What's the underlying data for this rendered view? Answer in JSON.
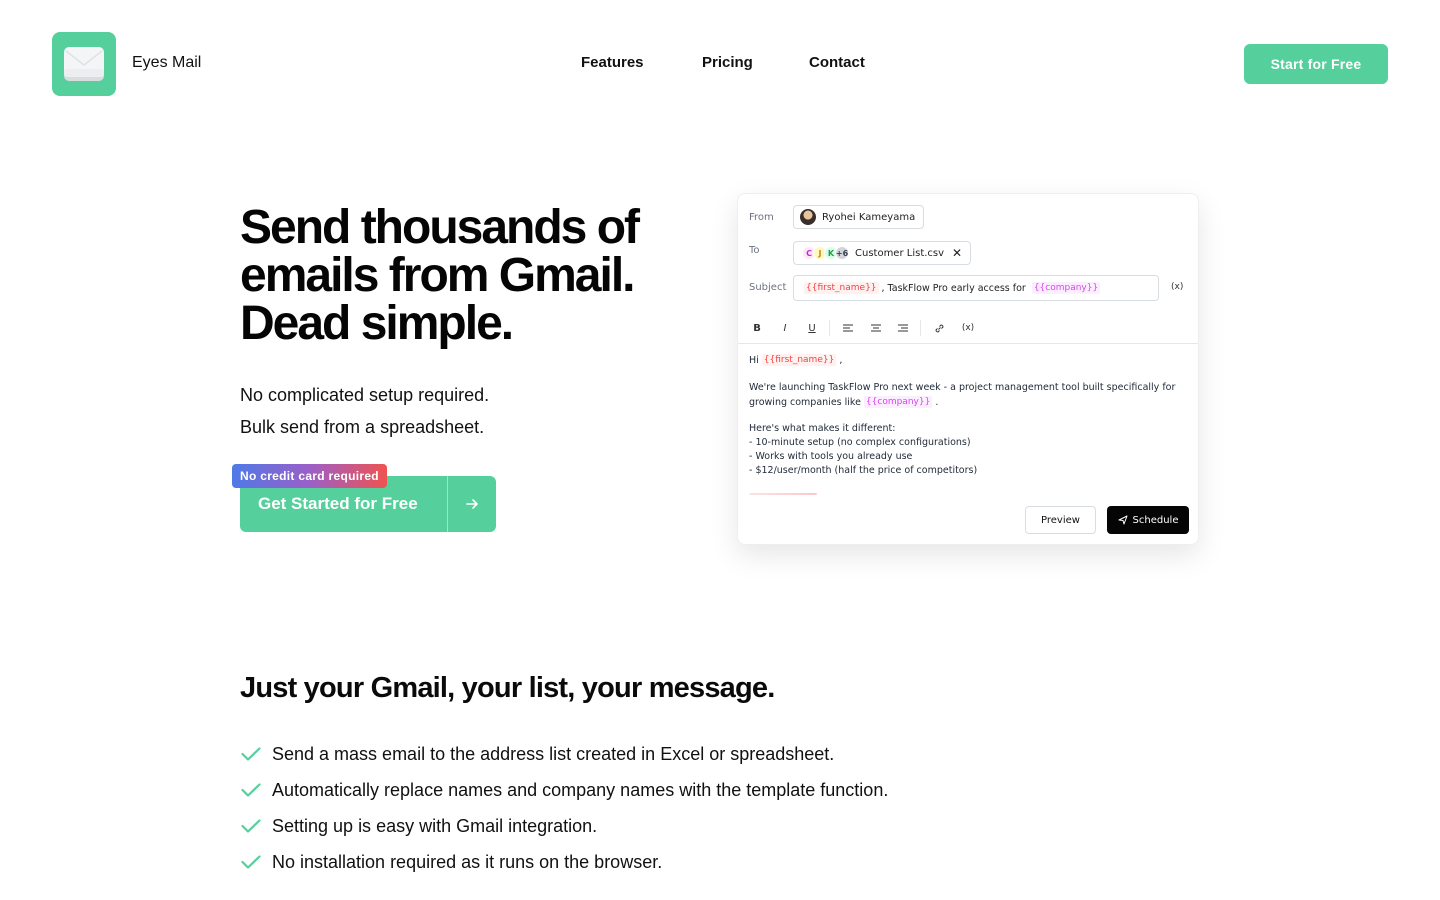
{
  "header": {
    "brand": "Eyes Mail",
    "nav": [
      "Features",
      "Pricing",
      "Contact"
    ],
    "cta": "Start for Free",
    "logo_icon": "envelope-icon"
  },
  "hero": {
    "title_lines": [
      "Send thousands of",
      "emails from Gmail.",
      "Dead simple."
    ],
    "subtitle_lines": [
      "No complicated setup required.",
      "Bulk send from a spreadsheet."
    ],
    "badge": "No credit card required",
    "cta": "Get Started for Free",
    "cta_icon": "arrow-right-icon"
  },
  "mock": {
    "from_label": "From",
    "from_value": "Ryohei Kameyama",
    "to_label": "To",
    "to_avatars": [
      "C",
      "J",
      "K"
    ],
    "to_more": "+6",
    "to_file": "Customer List.csv",
    "subject_label": "Subject",
    "subject_var1": "{{first_name}}",
    "subject_text": ", TaskFlow Pro early access for",
    "subject_var2": "{{company}}",
    "insert_var_icon": "(x)",
    "toolbar": [
      "B",
      "I",
      "U"
    ],
    "body": {
      "greeting": "Hi",
      "greeting_var": "{{first_name}}",
      "greeting_end": ",",
      "line1": "We're launching TaskFlow Pro next week - a project management tool built specifically for",
      "line2": "growing companies like",
      "line2_var": "{{company}}",
      "line2_end": ".",
      "line3": "Here's what makes it different:",
      "bullets": [
        "- 10-minute setup (no complex configurations)",
        "- Works with tools you already use",
        "- $12/user/month (half the price of competitors)"
      ]
    },
    "preview": "Preview",
    "schedule": "Schedule"
  },
  "features": {
    "title": "Just your Gmail, your list, your message.",
    "items": [
      "Send a mass email to the address list created in Excel or spreadsheet.",
      "Automatically replace names and company names with the template function.",
      "Setting up is easy with Gmail integration.",
      "No installation required as it runs on the browser."
    ],
    "check_color": "#55cf9b"
  },
  "colors": {
    "accent": "#55cf9b",
    "dark": "#050505"
  }
}
